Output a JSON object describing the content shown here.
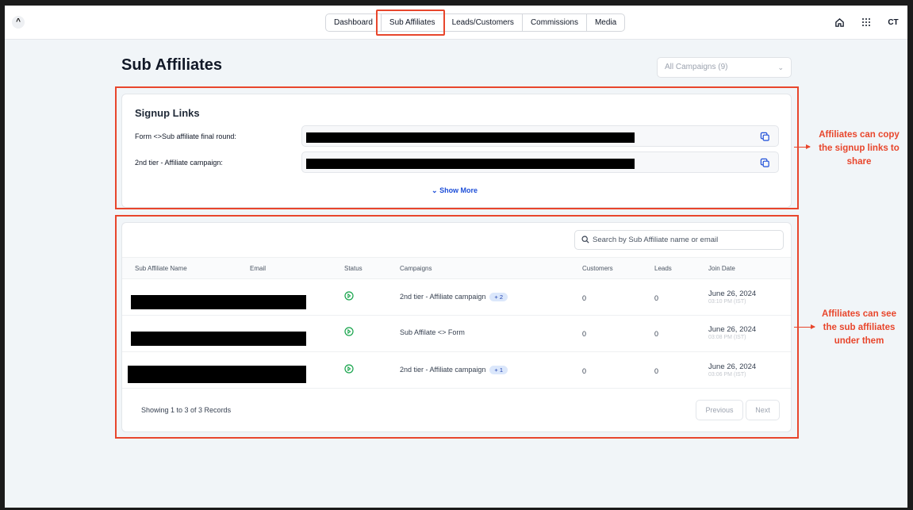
{
  "header": {
    "logo_glyph": "^",
    "tabs": [
      {
        "label": "Dashboard"
      },
      {
        "label": "Sub Affiliates"
      },
      {
        "label": "Leads/Customers"
      },
      {
        "label": "Commissions"
      },
      {
        "label": "Media"
      }
    ],
    "active_tab": "Sub Affiliates",
    "home_icon": "home-icon",
    "apps_icon": "grid-icon",
    "avatar_initials": "CT"
  },
  "page": {
    "title": "Sub Affiliates",
    "campaign_filter": "All Campaigns (9)"
  },
  "signup": {
    "title": "Signup Links",
    "links": [
      {
        "label": "Form <>Sub affiliate final round:"
      },
      {
        "label": "2nd tier - Affiliate campaign:"
      }
    ],
    "show_more": "Show More"
  },
  "table": {
    "search_placeholder": "Search by Sub Affiliate name or email",
    "columns": [
      "Sub Affiliate Name",
      "Email",
      "Status",
      "Campaigns",
      "Customers",
      "Leads",
      "Join Date"
    ],
    "rows": [
      {
        "campaign": "2nd tier - Affiliate campaign",
        "extra": "+ 2",
        "customers": "0",
        "leads": "0",
        "date": "June 26, 2024",
        "time": "03:10 PM (IST)"
      },
      {
        "campaign": "Sub Affilate <> Form",
        "extra": "",
        "customers": "0",
        "leads": "0",
        "date": "June 26, 2024",
        "time": "03:08 PM (IST)"
      },
      {
        "campaign": "2nd tier - Affiliate campaign",
        "extra": "+ 1",
        "customers": "0",
        "leads": "0",
        "date": "June 26, 2024",
        "time": "03:06 PM (IST)"
      }
    ],
    "footer": "Showing 1 to 3 of 3 Records",
    "prev": "Previous",
    "next": "Next"
  },
  "annotations": {
    "copy": [
      "Affiliates can copy",
      "the signup links to",
      "share"
    ],
    "see": [
      "Affiliates can see",
      "the sub affiliates",
      "under them"
    ]
  },
  "colors": {
    "highlight": "#e8462c",
    "status_active": "#16a34a",
    "link": "#1d4ed8"
  }
}
